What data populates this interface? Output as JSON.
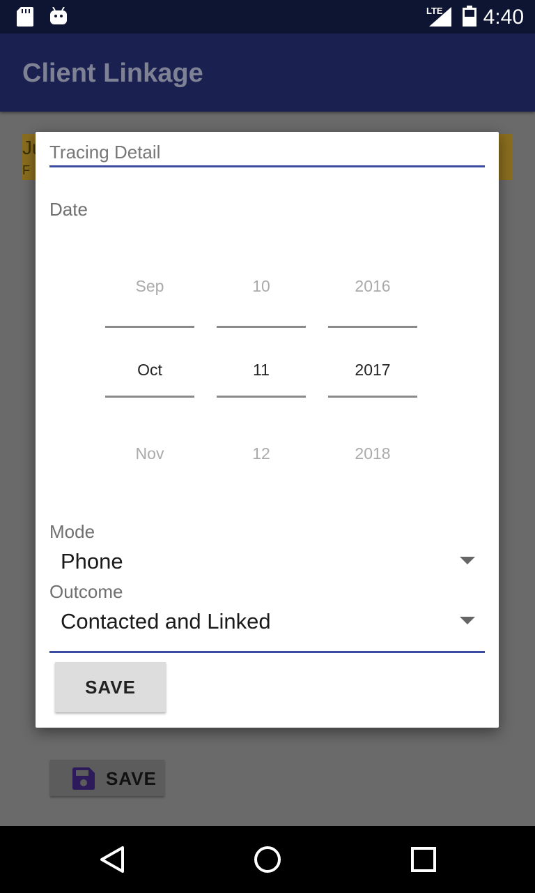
{
  "status_bar": {
    "time": "4:40",
    "network": "LTE",
    "icons": [
      "sd-card-icon",
      "android-debug-icon",
      "signal-icon",
      "battery-icon"
    ]
  },
  "app_bar": {
    "title": "Client Linkage"
  },
  "background": {
    "card_line1": "Ju",
    "card_line2": "F",
    "save_label": "SAVE",
    "card_color": "#8a6d1e"
  },
  "dialog": {
    "title": "Tracing Detail",
    "date_label": "Date",
    "picker": {
      "month": {
        "prev": "Sep",
        "current": "Oct",
        "next": "Nov"
      },
      "day": {
        "prev": "10",
        "current": "11",
        "next": "12"
      },
      "year": {
        "prev": "2016",
        "current": "2017",
        "next": "2018"
      }
    },
    "mode_label": "Mode",
    "mode_value": "Phone",
    "outcome_label": "Outcome",
    "outcome_value": "Contacted and Linked",
    "save_label": "SAVE",
    "accent_color": "#3b4ca1"
  },
  "nav_bar": {
    "buttons": [
      "back-icon",
      "home-icon",
      "recents-icon"
    ]
  }
}
